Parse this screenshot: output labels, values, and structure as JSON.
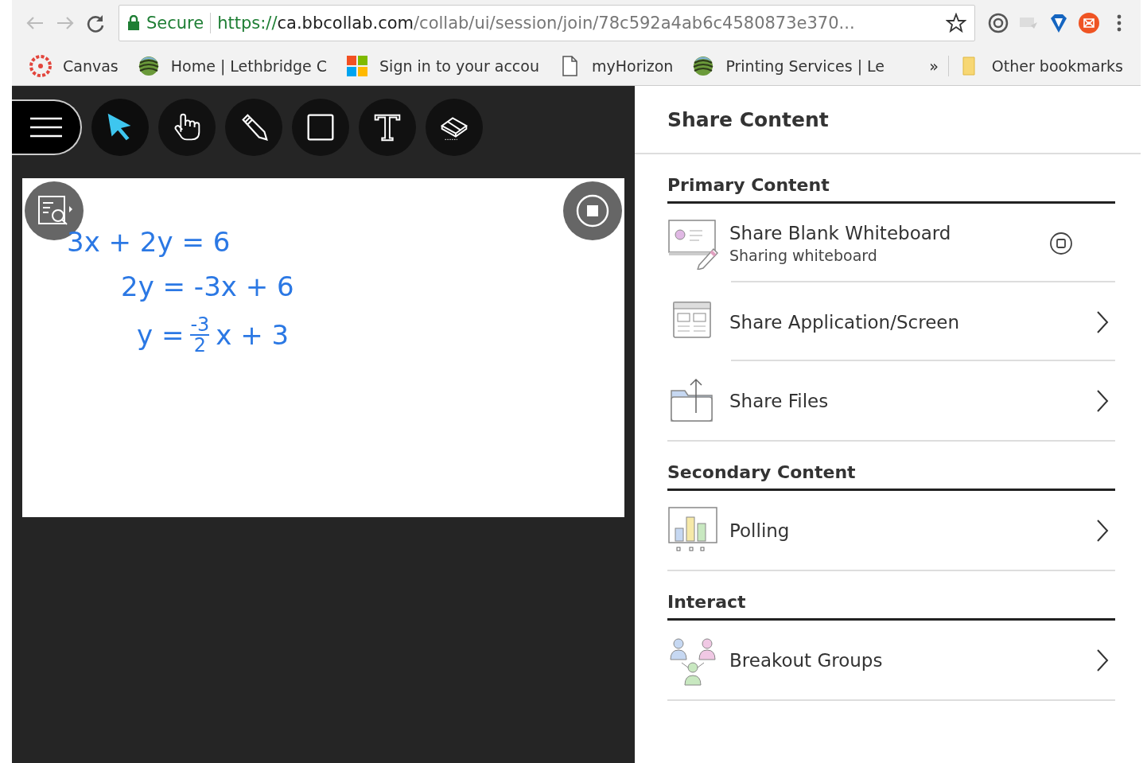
{
  "browser": {
    "url_secure_label": "Secure",
    "url_scheme": "https://",
    "url_host": "ca.bbcollab.com",
    "url_path": "/collab/ui/session/join/78c592a4ab6c4580873e370...",
    "bookmarks": [
      {
        "label": "Canvas",
        "kind": "canvas"
      },
      {
        "label": "Home | Lethbridge C",
        "kind": "globe"
      },
      {
        "label": "Sign in to your accou",
        "kind": "windows"
      },
      {
        "label": "myHorizon",
        "kind": "page"
      },
      {
        "label": "Printing Services | Le",
        "kind": "globe"
      }
    ],
    "overflow": "»",
    "other_bookmarks": "Other bookmarks"
  },
  "toolbar": {
    "tools": [
      {
        "kind": "pointer",
        "selected": true
      },
      {
        "kind": "hand",
        "selected": false
      },
      {
        "kind": "pencil",
        "selected": false
      },
      {
        "kind": "shape",
        "selected": false
      },
      {
        "kind": "text",
        "selected": false
      },
      {
        "kind": "eraser",
        "selected": false
      }
    ]
  },
  "whiteboard": {
    "lines": [
      {
        "kind": "plain",
        "text": "3x + 2y = 6"
      },
      {
        "kind": "plain",
        "text": "2y = -3x + 6"
      },
      {
        "kind": "fraction",
        "before": "y =",
        "numerator": "-3",
        "denominator": "2",
        "after": "x + 3"
      }
    ]
  },
  "panel": {
    "title": "Share Content",
    "sections": [
      {
        "heading": "Primary Content",
        "items": [
          {
            "kind": "whiteboard",
            "label": "Share Blank Whiteboard",
            "subtitle": "Sharing whiteboard",
            "active": true
          },
          {
            "kind": "application",
            "label": "Share Application/Screen",
            "active": false
          },
          {
            "kind": "files",
            "label": "Share Files",
            "active": false
          }
        ]
      },
      {
        "heading": "Secondary Content",
        "items": [
          {
            "kind": "polling",
            "label": "Polling",
            "active": false
          }
        ]
      },
      {
        "heading": "Interact",
        "items": [
          {
            "kind": "groups",
            "label": "Breakout Groups",
            "active": false
          }
        ]
      }
    ]
  }
}
